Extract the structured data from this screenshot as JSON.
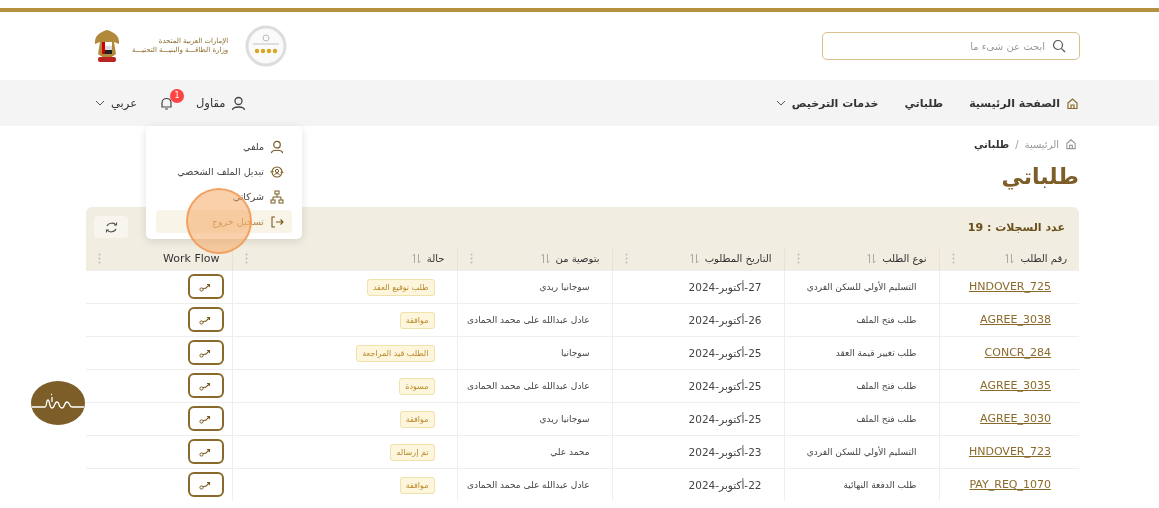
{
  "header": {
    "emblem_lines": [
      "الإمارات العربية المتحدة",
      "وزارة الطاقـــة والبنيـــة التحتيـــة"
    ],
    "search": {
      "placeholder": "ابحث عن شيء ما"
    }
  },
  "nav": {
    "items": [
      {
        "label": "الصفحة الرئيسية",
        "kind": "home"
      },
      {
        "label": "طلباتي",
        "kind": "plain"
      },
      {
        "label": "خدمات الترخيص",
        "kind": "dropdown"
      }
    ],
    "user": "مقاول",
    "notifications": "1",
    "language": "عربي"
  },
  "user_menu": [
    {
      "label": "ملفي",
      "kind": "profile",
      "selected": false
    },
    {
      "label": "تبديل الملف الشخصي",
      "kind": "switch",
      "selected": false
    },
    {
      "label": "شركاتي",
      "kind": "companies",
      "selected": false
    },
    {
      "label": "تسجيل خروج",
      "kind": "logout",
      "selected": true
    }
  ],
  "breadcrumb": {
    "items": [
      "الرئيسية",
      "طلباتي"
    ],
    "separator": "/"
  },
  "title": "طلباتي",
  "table": {
    "record_count": "عدد السجلات : 19",
    "columns": [
      {
        "label": "رقم الطلب",
        "sortable": true
      },
      {
        "label": "نوع الطلب",
        "sortable": true
      },
      {
        "label": "التاريخ المطلوب",
        "sortable": true
      },
      {
        "label": "بتوصية من",
        "sortable": true
      },
      {
        "label": "حالة",
        "sortable": true
      },
      {
        "label": "Work Flow",
        "sortable": false
      }
    ],
    "rows": [
      {
        "id": "HNDOVER_725",
        "type": "التسليم الأولي للسكن الفردي",
        "date": "27-أكتوبر-2024",
        "by": "سوجانيا ريدي",
        "status": "طلب توقيع العقد"
      },
      {
        "id": "AGREE_3038",
        "type": "طلب فتح الملف",
        "date": "26-أكتوبر-2024",
        "by": "عادل عبدالله على محمد الحمادى",
        "status": "موافقة"
      },
      {
        "id": "CONCR_284",
        "type": "طلب تغيير قيمة العقد",
        "date": "25-أكتوبر-2024",
        "by": "سوجانيا",
        "status": "الطلب قيد المراجعة"
      },
      {
        "id": "AGREE_3035",
        "type": "طلب فتح الملف",
        "date": "25-أكتوبر-2024",
        "by": "عادل عبدالله على محمد الحمادى",
        "status": "مسودة"
      },
      {
        "id": "AGREE_3030",
        "type": "طلب فتح الملف",
        "date": "25-أكتوبر-2024",
        "by": "سوجانيا ريدي",
        "status": "موافقة"
      },
      {
        "id": "HNDOVER_723",
        "type": "التسليم الأولي للسكن الفردي",
        "date": "23-أكتوبر-2024",
        "by": "محمد علي",
        "status": "تم إرساله"
      },
      {
        "id": "PAY_REQ_1070",
        "type": "طلب الدفعة النهائية",
        "date": "22-أكتوبر-2024",
        "by": "عادل عبدالله على محمد الحمادى",
        "status": "موافقة"
      }
    ]
  }
}
